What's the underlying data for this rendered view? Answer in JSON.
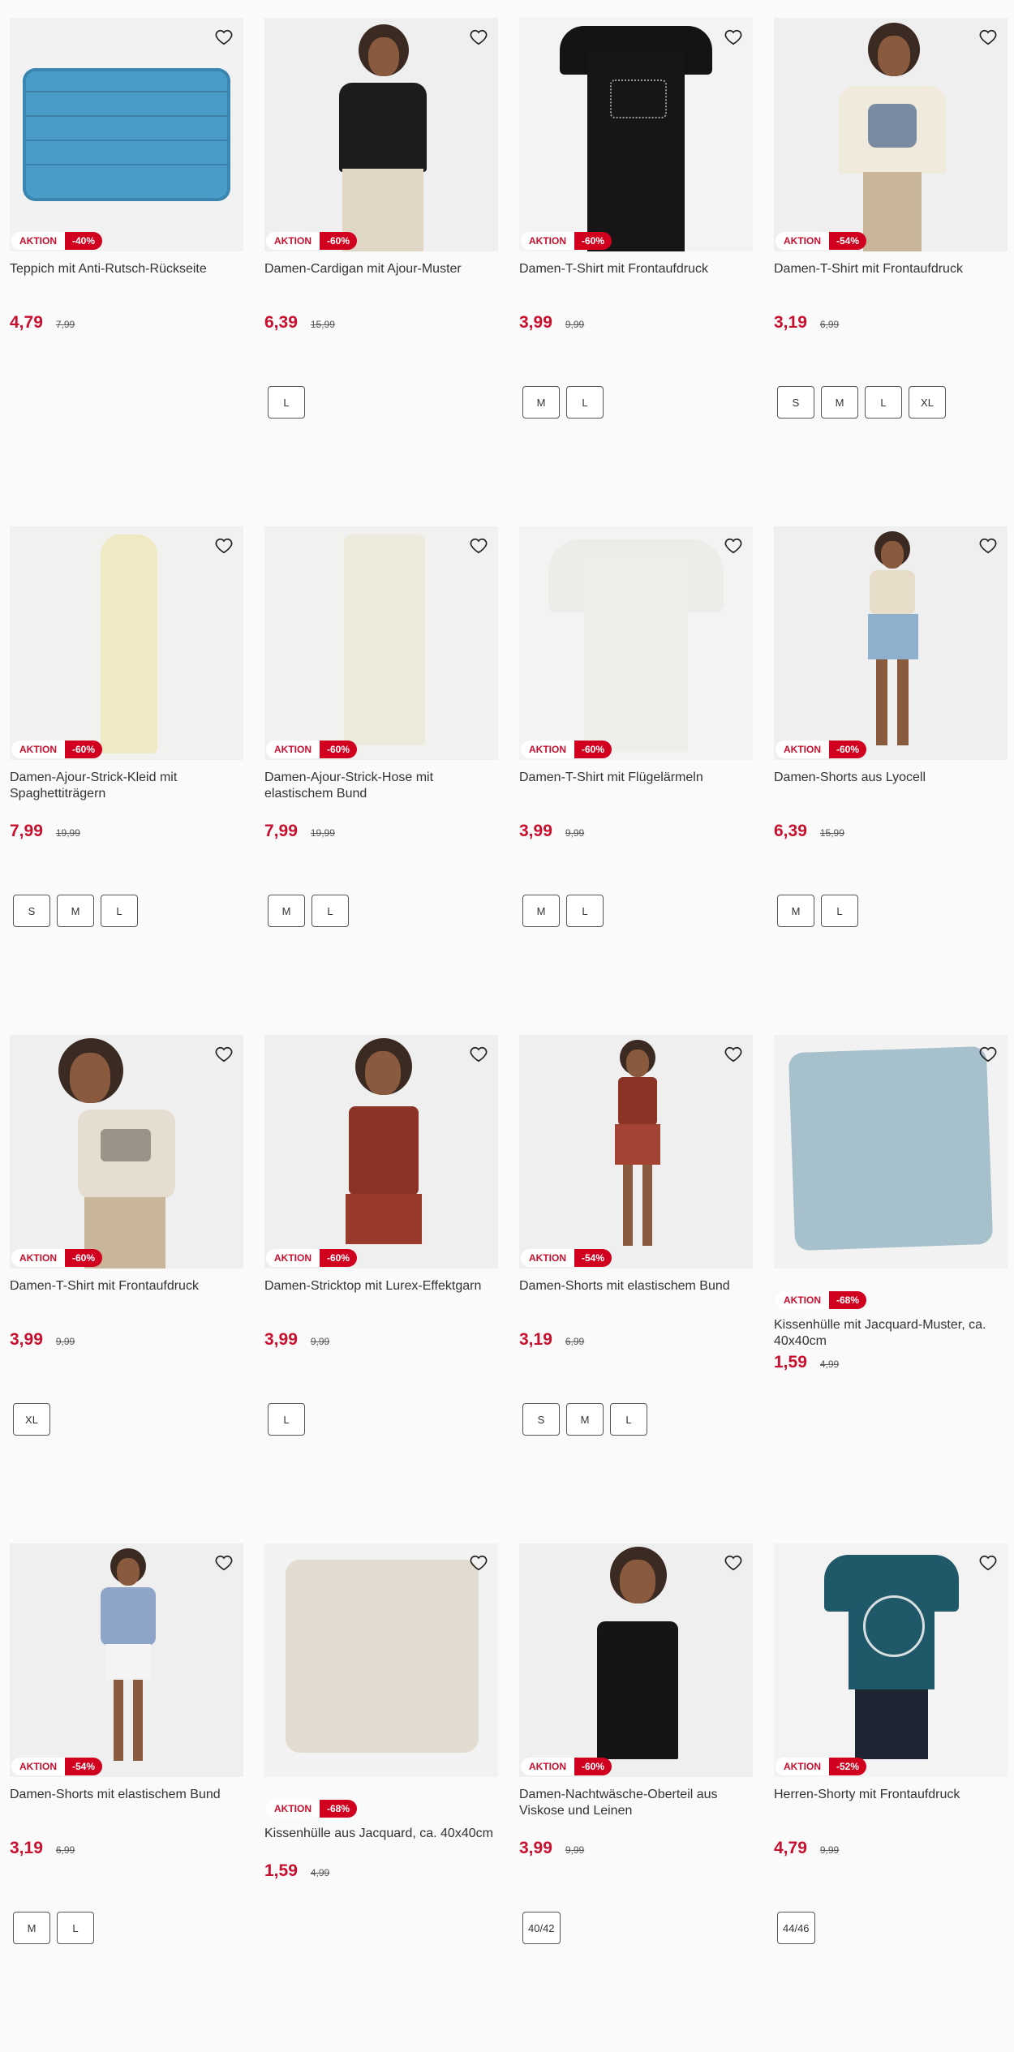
{
  "colors": {
    "accent": "#d1001f",
    "price": "#c8102e"
  },
  "products": [
    {
      "title": "Teppich mit Anti-Rutsch-Rückseite",
      "aktion": "AKTION",
      "discount": "-40%",
      "price": "4,79",
      "old": "7,99",
      "sizes": []
    },
    {
      "title": "Damen-Cardigan mit Ajour-Muster",
      "aktion": "AKTION",
      "discount": "-60%",
      "price": "6,39",
      "old": "15,99",
      "sizes": [
        "L"
      ]
    },
    {
      "title": "Damen-T-Shirt mit Frontaufdruck",
      "aktion": "AKTION",
      "discount": "-60%",
      "price": "3,99",
      "old": "9,99",
      "sizes": [
        "M",
        "L"
      ]
    },
    {
      "title": "Damen-T-Shirt mit Frontaufdruck",
      "aktion": "AKTION",
      "discount": "-54%",
      "price": "3,19",
      "old": "6,99",
      "sizes": [
        "S",
        "M",
        "L",
        "XL"
      ]
    },
    {
      "title": "Damen-Ajour-Strick-Kleid mit Spaghettiträgern",
      "aktion": "AKTION",
      "discount": "-60%",
      "price": "7,99",
      "old": "19,99",
      "sizes": [
        "S",
        "M",
        "L"
      ]
    },
    {
      "title": "Damen-Ajour-Strick-Hose mit elastischem Bund",
      "aktion": "AKTION",
      "discount": "-60%",
      "price": "7,99",
      "old": "19,99",
      "sizes": [
        "M",
        "L"
      ]
    },
    {
      "title": "Damen-T-Shirt mit Flügelärmeln",
      "aktion": "AKTION",
      "discount": "-60%",
      "price": "3,99",
      "old": "9,99",
      "sizes": [
        "M",
        "L"
      ]
    },
    {
      "title": "Damen-Shorts aus Lyocell",
      "aktion": "AKTION",
      "discount": "-60%",
      "price": "6,39",
      "old": "15,99",
      "sizes": [
        "M",
        "L"
      ]
    },
    {
      "title": "Damen-T-Shirt mit Frontaufdruck",
      "aktion": "AKTION",
      "discount": "-60%",
      "price": "3,99",
      "old": "9,99",
      "sizes": [
        "XL"
      ]
    },
    {
      "title": "Damen-Stricktop mit Lurex-Effektgarn",
      "aktion": "AKTION",
      "discount": "-60%",
      "price": "3,99",
      "old": "9,99",
      "sizes": [
        "L"
      ]
    },
    {
      "title": "Damen-Shorts mit elastischem Bund",
      "aktion": "AKTION",
      "discount": "-54%",
      "price": "3,19",
      "old": "6,99",
      "sizes": [
        "S",
        "M",
        "L"
      ]
    },
    {
      "title": "Kissenhülle mit Jacquard-Muster, ca. 40x40cm",
      "aktion": "AKTION",
      "discount": "-68%",
      "price": "1,59",
      "old": "4,99",
      "sizes": []
    },
    {
      "title": "Damen-Shorts mit elastischem Bund",
      "aktion": "AKTION",
      "discount": "-54%",
      "price": "3,19",
      "old": "6,99",
      "sizes": [
        "M",
        "L"
      ]
    },
    {
      "title": "Kissenhülle aus Jacquard, ca. 40x40cm",
      "aktion": "AKTION",
      "discount": "-68%",
      "price": "1,59",
      "old": "4,99",
      "sizes": []
    },
    {
      "title": "Damen-Nachtwäsche-Oberteil aus Viskose und Leinen",
      "aktion": "AKTION",
      "discount": "-60%",
      "price": "3,99",
      "old": "9,99",
      "sizes": [
        "40/42"
      ]
    },
    {
      "title": "Herren-Shorty mit Frontaufdruck",
      "aktion": "AKTION",
      "discount": "-52%",
      "price": "4,79",
      "old": "9,99",
      "sizes": [
        "44/46"
      ]
    }
  ]
}
